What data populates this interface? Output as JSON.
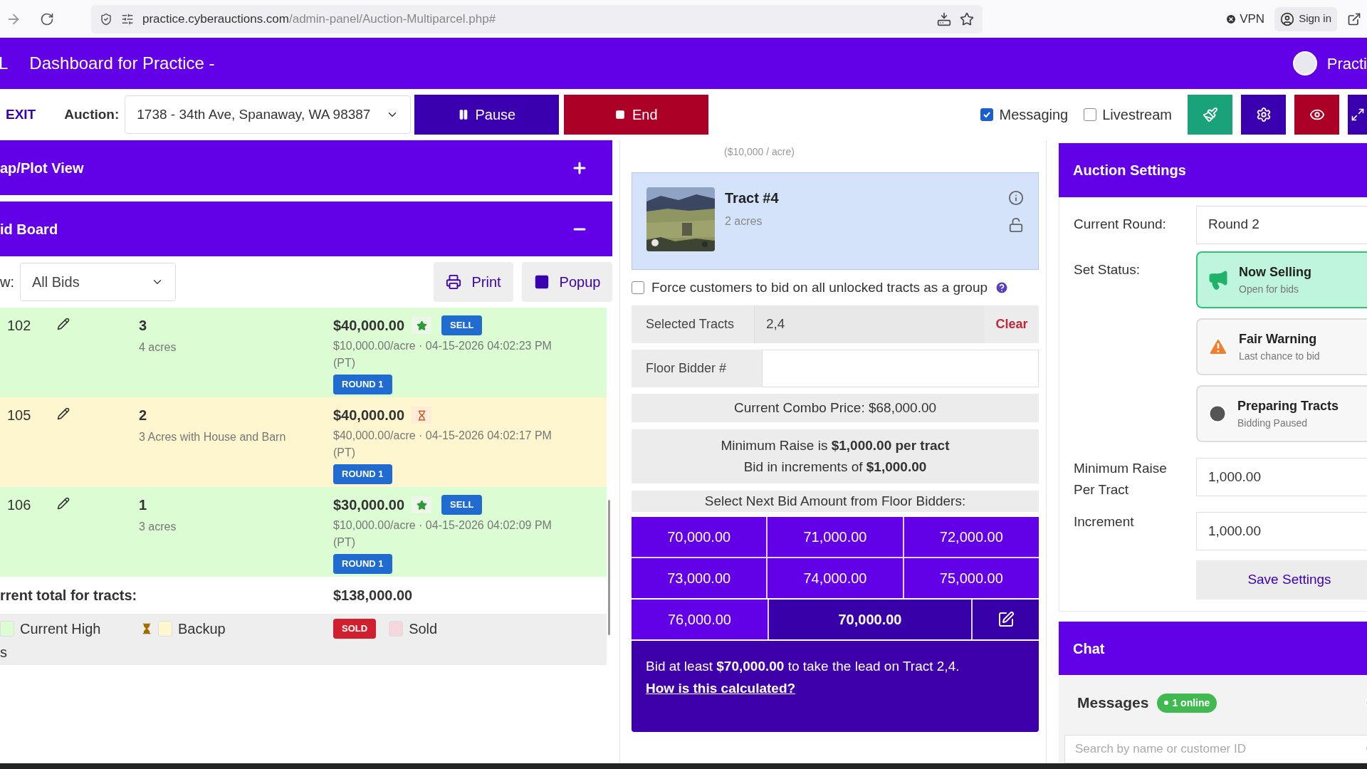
{
  "browser": {
    "url_host": "practice.cyberauctions.com",
    "url_path": "/admin-panel/Auction-Multiparcel.php#",
    "vpn": "VPN",
    "sign_in": "Sign in"
  },
  "header": {
    "logo_fragment": "L",
    "title": "Dashboard for Practice -",
    "user": "Practi"
  },
  "toolbar": {
    "exit": "EXIT",
    "auction_label": "Auction:",
    "auction_value": "1738 - 34th Ave, Spanaway, WA 98387",
    "pause": "Pause",
    "end": "End",
    "toggles": [
      {
        "label": "Messaging",
        "checked": true
      },
      {
        "label": "Livestream",
        "checked": false
      }
    ]
  },
  "left": {
    "panels": [
      {
        "title": "ap/Plot View",
        "expanded": false
      },
      {
        "title": "id Board",
        "expanded": true
      }
    ],
    "view_label": "w:",
    "view_value": "All Bids",
    "print": "Print",
    "popup": "Popup",
    "bids": [
      {
        "bidder": "102",
        "tract": "3",
        "desc": "4 acres",
        "amount": "$40,000.00",
        "leading": true,
        "badge": "SELL",
        "detail": "$10,000.00/acre · 04-15-2026 04:02:23 PM (PT)",
        "round": "ROUND 1"
      },
      {
        "bidder": "105",
        "tract": "2",
        "desc": "3 Acres with House and Barn",
        "amount": "$40,000.00",
        "leading": false,
        "detail": "$40,000.00/acre · 04-15-2026 04:02:17 PM (PT)",
        "round": "ROUND 1"
      },
      {
        "bidder": "106",
        "tract": "1",
        "desc": "3 acres",
        "amount": "$30,000.00",
        "leading": true,
        "badge": "SELL",
        "detail": "$10,000.00/acre · 04-15-2026 04:02:09 PM (PT)",
        "round": "ROUND 1"
      }
    ],
    "total_label": "rrent total for tracts:",
    "total": "$138,000.00",
    "legend": [
      {
        "kind": "high",
        "label": "Current High"
      },
      {
        "kind": "backup",
        "label": "Backup"
      },
      {
        "kind": "sold",
        "badge": "SOLD",
        "label": "Sold"
      }
    ],
    "legend_more": "s"
  },
  "middle": {
    "rate_fragment": "($10,000 / acre)",
    "tract": {
      "name": "Tract #4",
      "acres": "2 acres",
      "selected": true
    },
    "force_group": {
      "label": "Force customers to bid on all unlocked tracts as a group",
      "checked": false
    },
    "selected_tracts": {
      "label": "Selected Tracts",
      "value": "2,4",
      "clear": "Clear"
    },
    "floor_bidder": {
      "label": "Floor Bidder #"
    },
    "combo": "Current Combo Price: $68,000.00",
    "min_raise": "Minimum Raise is **$1,000.00 per tract**",
    "increments": "Bid in increments of **$1,000.00**",
    "select_next": "Select Next Bid Amount from Floor Bidders:",
    "amounts": [
      "70,000.00",
      "71,000.00",
      "72,000.00",
      "73,000.00",
      "74,000.00",
      "75,000.00",
      "76,000.00"
    ],
    "custom_amount": "70,000.00",
    "lead_note": "Bid at least **$70,000.00** to take the lead on Tract 2,4.",
    "lead_link": "How is this calculated?"
  },
  "settings": {
    "title": "Auction Settings",
    "round_label": "Current Round:",
    "round": "Round 2",
    "status_label": "Set Status:",
    "statuses": [
      {
        "kind": "selling",
        "title": "Now Selling",
        "sub": "Open for bids",
        "selected": true
      },
      {
        "kind": "warning",
        "title": "Fair Warning",
        "sub": "Last chance to bid",
        "selected": false
      },
      {
        "kind": "paused",
        "title": "Preparing Tracts",
        "sub": "Bidding Paused",
        "selected": false
      }
    ],
    "min_raise_label": "Minimum Raise Per Tract",
    "min_raise": "1,000.00",
    "increment_label": "Increment",
    "increment": "1,000.00",
    "save": "Save Settings"
  },
  "chat": {
    "title": "Chat",
    "messages": "Messages",
    "online": "1 online",
    "search_placeholder": "Search by name or customer ID"
  }
}
